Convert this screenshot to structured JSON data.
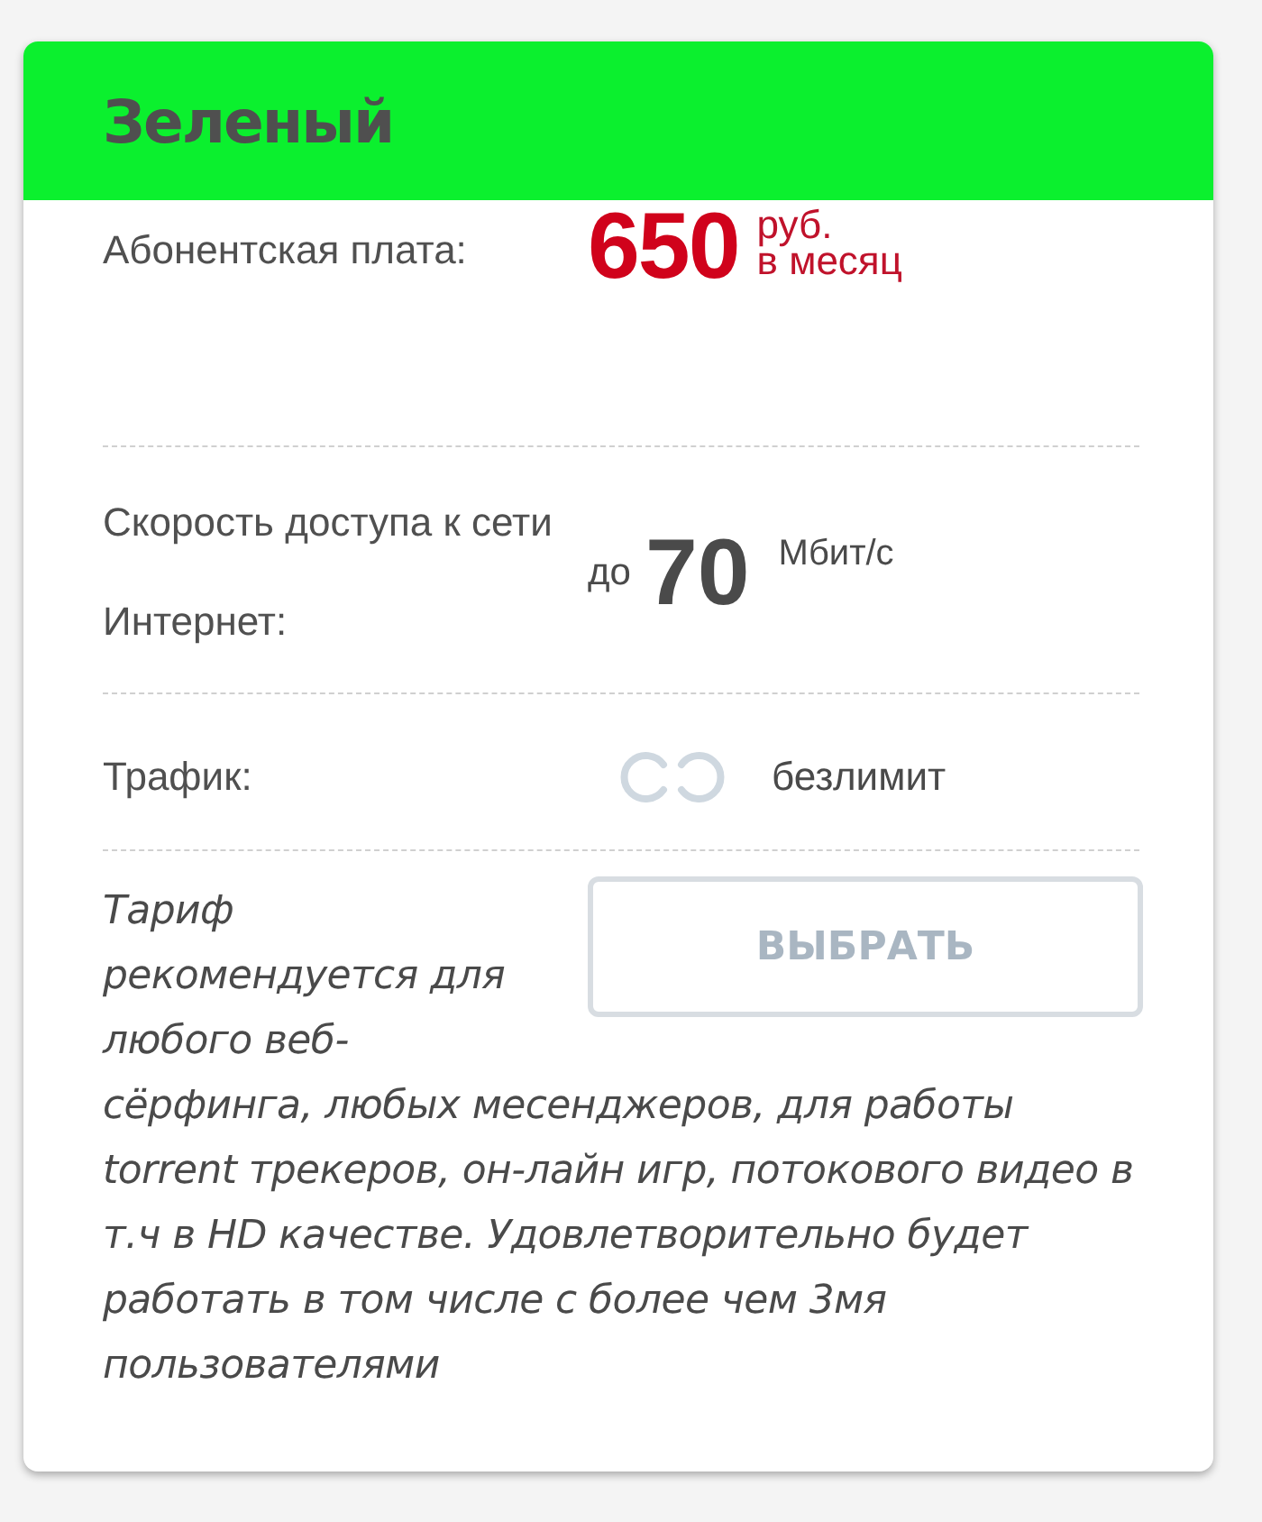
{
  "title": "Зеленый",
  "rows": [
    {
      "kind": "price",
      "label": "Абонентская плата:",
      "value": "650",
      "unit": [
        "руб.",
        "в месяц"
      ]
    },
    {
      "kind": "speed",
      "label": "Скорость доступа к сети Интернет:",
      "prefix": "до",
      "value": "70",
      "unit": "Мбит/с"
    },
    {
      "kind": "traffic",
      "label": "Трафик:",
      "value": "безлимит"
    }
  ],
  "description": [
    "Тариф рекомендуется для любого веб-",
    "сёрфинга, любых месенджеров, для работы torrent трекеров, он-лайн игр, потокового видео в т.ч в HD качестве. Удовлетворительно будет работать в том числе с более чем 3мя пользователями"
  ],
  "button": "ВЫБРАТЬ"
}
